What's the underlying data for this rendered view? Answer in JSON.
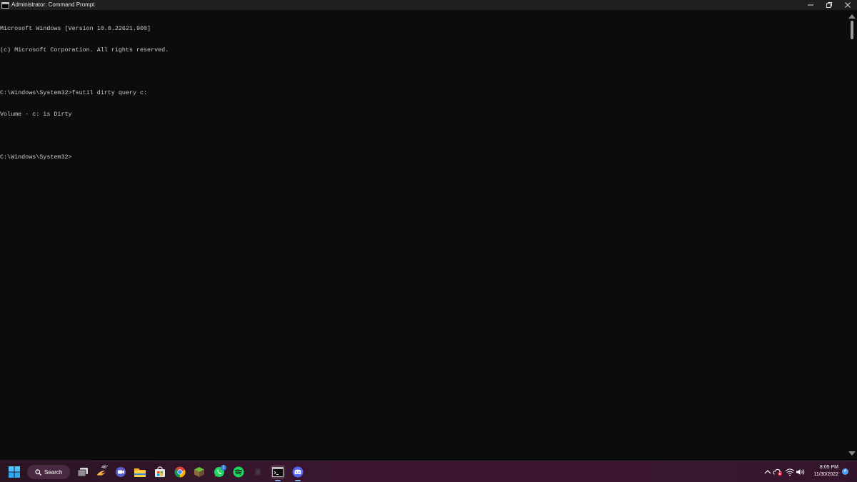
{
  "window": {
    "title": "Administrator: Command Prompt"
  },
  "console": {
    "lines": [
      "Microsoft Windows [Version 10.0.22621.900]",
      "(c) Microsoft Corporation. All rights reserved.",
      "",
      "C:\\Windows\\System32>fsutil dirty query c:",
      "Volume - c: is Dirty",
      "",
      "C:\\Windows\\System32>"
    ]
  },
  "taskbar": {
    "search_label": "Search",
    "weather_temp": "46°",
    "whatsapp_badge": "1",
    "clock_time": "8:05 PM",
    "clock_date": "11/30/2022",
    "notification_count": "4"
  },
  "colors": {
    "console_bg": "#0c0c0c",
    "console_text": "#cccccc",
    "taskbar_bg": "#3a1630",
    "accent": "#4a9fff"
  }
}
